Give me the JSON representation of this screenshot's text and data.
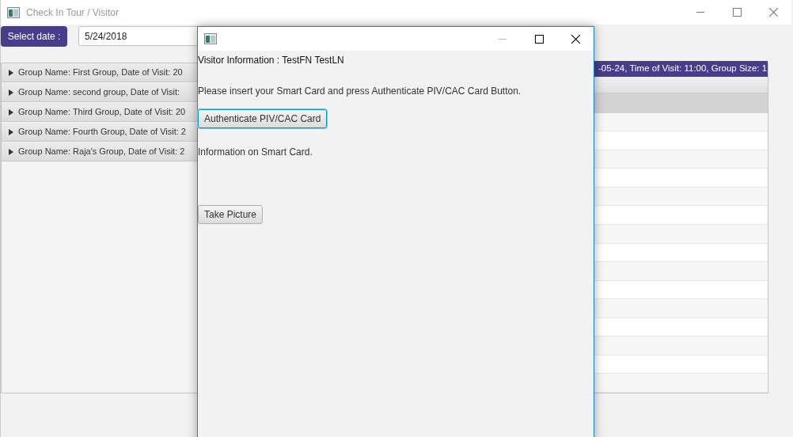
{
  "main_window": {
    "title": "Check In Tour / Visitor"
  },
  "date_picker": {
    "label": "Select date :",
    "value": "5/24/2018"
  },
  "groups": [
    {
      "label": "Group Name: First Group, Date of Visit: 20",
      "expanded": false
    },
    {
      "label": "Group Name: second group, Date of Visit:",
      "expanded": false
    },
    {
      "label": "Group Name: Third Group, Date of Visit: 20",
      "expanded": false
    },
    {
      "label": "Group Name: Fourth Group, Date of Visit: 2",
      "expanded": false
    },
    {
      "label": "Group Name: Raja's Group, Date of Visit: 2",
      "expanded": false
    }
  ],
  "group_details": {
    "header": "-05-24, Time of Visit: 11:00, Group Size: 1"
  },
  "dialog": {
    "heading": "Visitor Information : TestFN TestLN",
    "instruction": "Please insert your Smart Card and press Authenticate PIV/CAC Card Button.",
    "authenticate_button": {
      "label": "Authenticate PIV/CAC Card",
      "focused": true
    },
    "info_label": "Information on Smart Card.",
    "picture_button": {
      "label": "Take Picture",
      "focused": false
    }
  }
}
